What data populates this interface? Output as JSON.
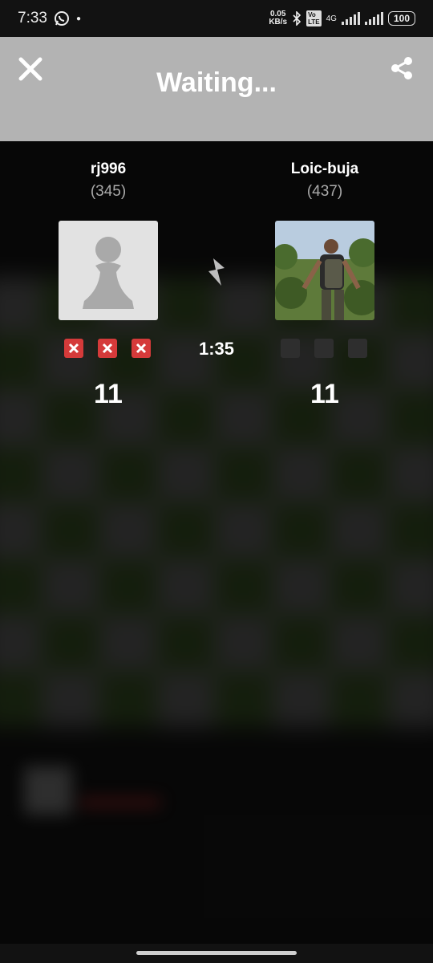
{
  "status_bar": {
    "time": "7:33",
    "net_speed_value": "0.05",
    "net_speed_unit": "KB/s",
    "network": "4G",
    "battery": "100"
  },
  "header": {
    "title": "Waiting...",
    "background": "#b3b3b3"
  },
  "match": {
    "time_control_icon": "lightning-bolt-icon",
    "timer": "1:35"
  },
  "players": {
    "left": {
      "name": "rj996",
      "rating": "(345)",
      "avatar": "pawn-avatar",
      "score": "11",
      "results": [
        "x",
        "x",
        "x"
      ]
    },
    "right": {
      "name": "Loic-buja",
      "rating": "(437)",
      "avatar": "photo-avatar",
      "score": "11",
      "results": [
        "empty",
        "empty",
        "empty"
      ]
    }
  },
  "colors": {
    "loss_mark": "#d53a3a",
    "empty_mark": "#2e2e2e",
    "board_light": "#6b6b6b",
    "board_dark": "#3a5a22"
  }
}
